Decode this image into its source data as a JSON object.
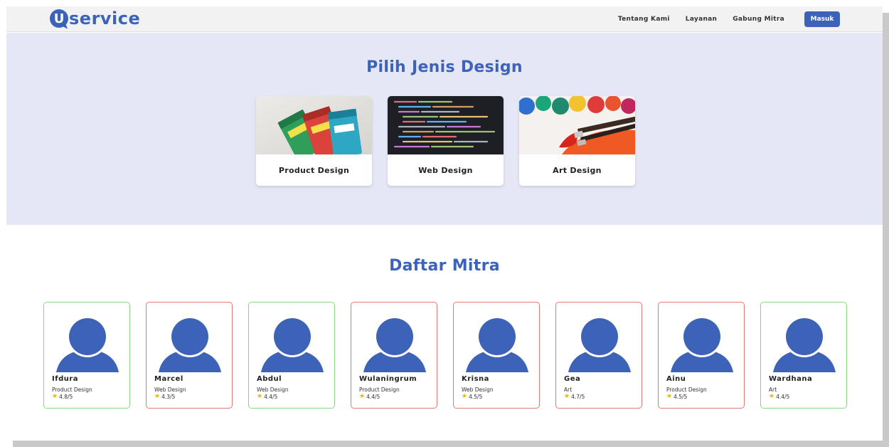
{
  "header": {
    "logo_letter": "U",
    "logo_text": "service",
    "nav": [
      {
        "label": "Tentang Kami"
      },
      {
        "label": "Layanan"
      },
      {
        "label": "Gabung Mitra"
      }
    ],
    "login_label": "Masuk"
  },
  "hero": {
    "title": "Pilih Jenis Design",
    "cards": [
      {
        "label": "Product Design",
        "image": "snack-packages-photo"
      },
      {
        "label": "Web Design",
        "image": "code-screen-photo"
      },
      {
        "label": "Art Design",
        "image": "paint-brush-photo"
      }
    ]
  },
  "mitra": {
    "title": "Daftar Mitra",
    "items": [
      {
        "name": "Ifdura",
        "category": "Product Design",
        "rating": "4.8/5",
        "status": "green"
      },
      {
        "name": "Marcel",
        "category": "Web Design",
        "rating": "4.3/5",
        "status": "red"
      },
      {
        "name": "Abdul",
        "category": "Web Design",
        "rating": "4.4/5",
        "status": "green"
      },
      {
        "name": "Wulaningrum",
        "category": "Product Design",
        "rating": "4.4/5",
        "status": "red"
      },
      {
        "name": "Krisna",
        "category": "Web Design",
        "rating": "4.5/5",
        "status": "red"
      },
      {
        "name": "Gea",
        "category": "Art",
        "rating": "4.7/5",
        "status": "red"
      },
      {
        "name": "Ainu",
        "category": "Product Design",
        "rating": "4.5/5",
        "status": "red"
      },
      {
        "name": "Wardhana",
        "category": "Art",
        "rating": "4.4/5",
        "status": "green"
      }
    ]
  },
  "colors": {
    "brand": "#3d63b8",
    "hero_bg": "#e6e7f6",
    "border_green": "#8fd18a",
    "border_red": "#e07a72",
    "star": "#f4b400"
  }
}
